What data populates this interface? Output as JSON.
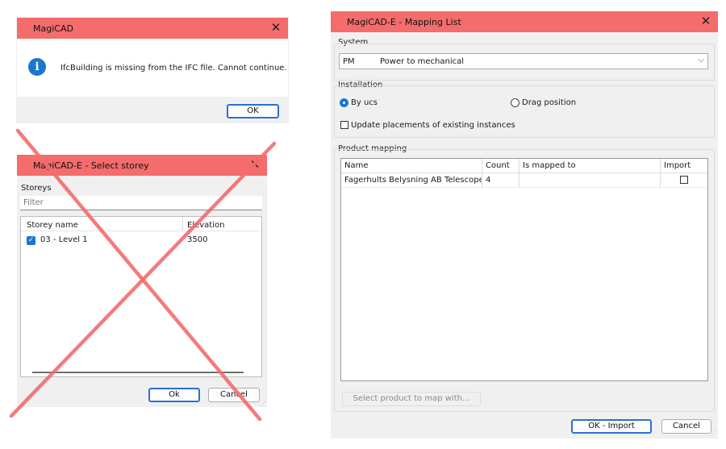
{
  "dialog_error": {
    "title": "MagiCAD",
    "message": "IfcBuilding is missing from the IFC file. Cannot continue.",
    "ok_label": "OK",
    "icon": "info-icon"
  },
  "dialog_storey": {
    "title": "MagiCAD-E - Select storey",
    "storeys_label": "Storeys",
    "filter_placeholder": "Filter",
    "columns": [
      "Storey name",
      "Elevation"
    ],
    "rows": [
      {
        "name": "03 - Level 1",
        "elevation": "3500",
        "checked": true
      }
    ],
    "ok_label": "Ok",
    "cancel_label": "Cancel",
    "crossed_out_color": "#f46c6c"
  },
  "dialog_mapping": {
    "title": "MagiCAD-E - Mapping List",
    "system_label": "System",
    "system_code": "PM",
    "system_name": "Power to mechanical",
    "installation_label": "Installation",
    "radio_by_ucs": "By ucs",
    "radio_drag": "Drag position",
    "update_checkbox_label": "Update placements of existing instances",
    "product_mapping_label": "Product mapping",
    "columns": [
      "Name",
      "Count",
      "Is mapped to",
      "Import"
    ],
    "rows": [
      {
        "name": "Fagerhults Belysning AB Telescope Aqu",
        "count": "4",
        "mapped_to": "",
        "import": false
      }
    ],
    "select_product_label": "Select product to map with...",
    "ok_import_label": "OK - Import",
    "cancel_label": "Cancel"
  },
  "colors": {
    "titlebar": "#f46c6c",
    "accent": "#2a6fd6"
  }
}
